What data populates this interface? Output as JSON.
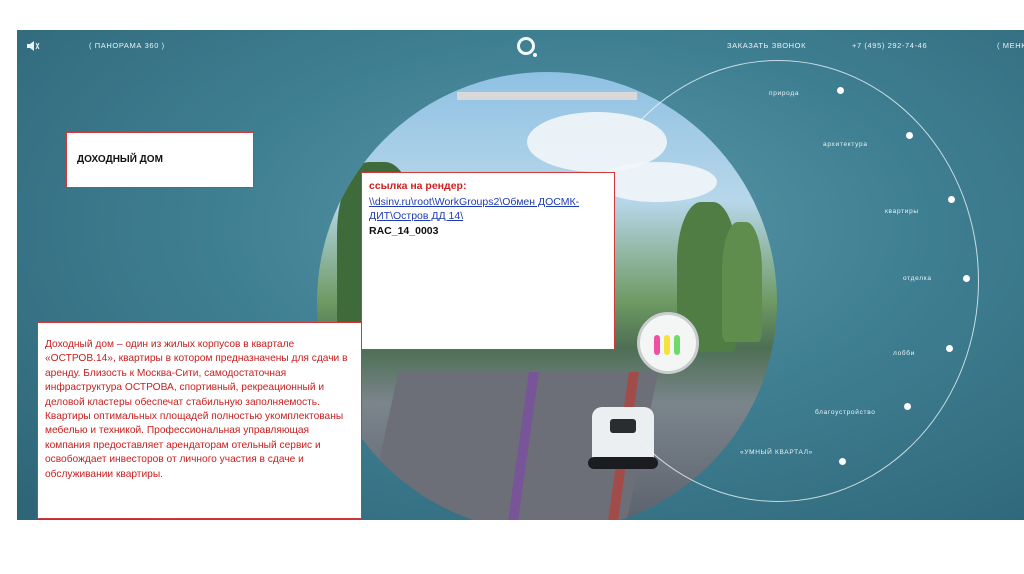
{
  "topbar": {
    "panorama": "( ПАНОРАМА 360 )",
    "callback": "ЗАКАЗАТЬ ЗВОНОК",
    "phone": "+7 (495) 292-74-46",
    "menu": "( МЕНЮ"
  },
  "nav": [
    "природа",
    "архитектура",
    "квартиры",
    "отделка",
    "лобби",
    "благоустройство",
    "«УМНЫЙ КВАРТАЛ»"
  ],
  "notes": {
    "title": "ДОХОДНЫЙ ДОМ",
    "link_label": "ссылка на рендер:",
    "link_path": "\\\\dsinv.ru\\root\\WorkGroups2\\Обмен ДОСМК-ДИТ\\Остров ДД 14\\",
    "render_id": "RAC_14_0003",
    "description": "Доходный дом – один из жилых корпусов в квартале «ОСТРОВ.14», квартиры в котором предназначены для сдачи в аренду. Близость к Москва-Сити, самодостаточная инфраструктура ОСТРОВА, спортивный, рекреационный и  деловой кластеры обеспечат стабильную заполняемость. Квартиры оптимальных площадей полностью укомплектованы мебелью и техникой. Профессиональная управляющая компания предоставляет арендаторам отельный сервис и освобождает инвесторов от личного участия в сдаче и обслуживании квартиры."
  },
  "icons": {
    "sound": "speaker-icon",
    "logo": "ostrov-logo",
    "badge_colors": [
      "#f04fa6",
      "#f5e23a",
      "#6fd96a"
    ]
  }
}
